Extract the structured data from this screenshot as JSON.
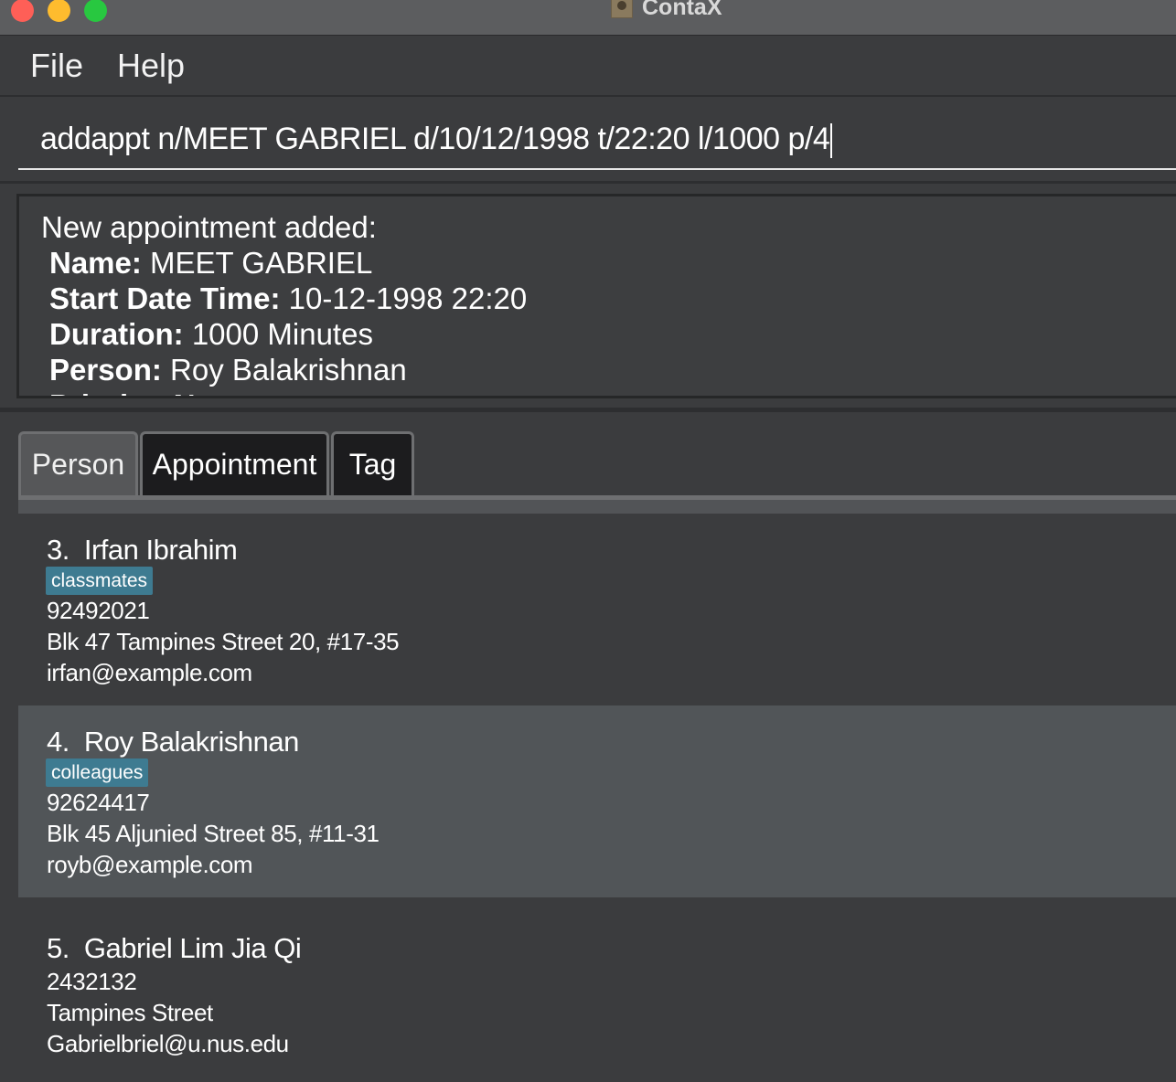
{
  "window": {
    "title": "ContaX",
    "icon": "contacts-app-icon"
  },
  "menu": {
    "file": "File",
    "help": "Help"
  },
  "command": {
    "value": "addappt n/MEET GABRIEL d/10/12/1998 t/22:20 l/1000 p/4"
  },
  "result": {
    "heading": "New appointment added:",
    "name_label": "Name:",
    "name_value": " MEET GABRIEL",
    "start_label": "Start Date Time:",
    "start_value": " 10-12-1998 22:20",
    "duration_label": "Duration:",
    "duration_value": " 1000 Minutes",
    "person_label": "Person:",
    "person_value": " Roy Balakrishnan",
    "priority_partial": "Priority: N"
  },
  "tabs": [
    {
      "label": "Person",
      "selected": true
    },
    {
      "label": "Appointment",
      "selected": false
    },
    {
      "label": "Tag",
      "selected": false
    }
  ],
  "persons": [
    {
      "index": "3.",
      "name": "Irfan Ibrahim",
      "tag": "classmates",
      "phone": "92492021",
      "address": "Blk 47 Tampines Street 20, #17-35",
      "email": "irfan@example.com"
    },
    {
      "index": "4.",
      "name": "Roy Balakrishnan",
      "tag": "colleagues",
      "phone": "92624417",
      "address": "Blk 45 Aljunied Street 85, #11-31",
      "email": "royb@example.com"
    },
    {
      "index": "5.",
      "name": "Gabriel Lim Jia Qi",
      "phone": "2432132",
      "address": "Tampines Street",
      "email": "Gabrielbriel@u.nus.edu"
    }
  ],
  "colors": {
    "background": "#3b3c3e",
    "selected_card": "#515558",
    "tag_badge": "#3e7b91",
    "close": "#fe5f57",
    "minimize": "#febc2e",
    "zoom": "#28c840"
  }
}
